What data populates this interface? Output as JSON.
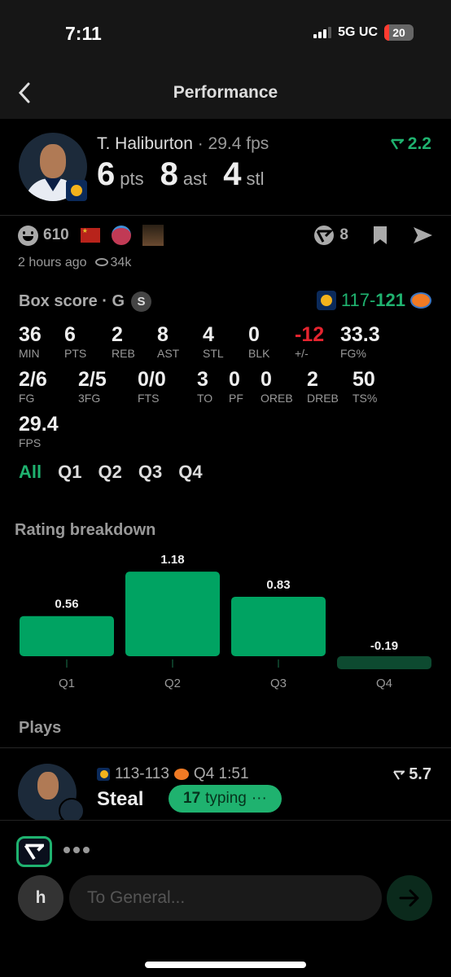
{
  "status_bar": {
    "time": "7:11",
    "network": "5G UC",
    "battery": "20"
  },
  "header": {
    "title": "Performance"
  },
  "player": {
    "name": "T. Haliburton",
    "fps": "· 29.4 fps",
    "rating": "2.2",
    "stats": [
      {
        "value": "6",
        "unit": "pts"
      },
      {
        "value": "8",
        "unit": "ast"
      },
      {
        "value": "4",
        "unit": "stl"
      }
    ]
  },
  "social": {
    "reaction_count": "610",
    "time_ago": "2 hours ago",
    "views": "34k",
    "vote_count": "8"
  },
  "box_score": {
    "title": "Box score · G",
    "badge": "S",
    "team_score": "117",
    "opp_score": "121",
    "score_sep": "-",
    "row1": [
      {
        "v": "36",
        "l": "MIN"
      },
      {
        "v": "6",
        "l": "PTS"
      },
      {
        "v": "2",
        "l": "REB"
      },
      {
        "v": "8",
        "l": "AST"
      },
      {
        "v": "4",
        "l": "STL"
      },
      {
        "v": "0",
        "l": "BLK"
      },
      {
        "v": "-12",
        "l": "+/-"
      },
      {
        "v": "33.3",
        "l": "FG%"
      }
    ],
    "row2": [
      {
        "v": "2/6",
        "l": "FG"
      },
      {
        "v": "2/5",
        "l": "3FG"
      },
      {
        "v": "0/0",
        "l": "FTS"
      },
      {
        "v": "3",
        "l": "TO"
      },
      {
        "v": "0",
        "l": "PF"
      },
      {
        "v": "0",
        "l": "OREB"
      },
      {
        "v": "2",
        "l": "DREB"
      },
      {
        "v": "50",
        "l": "TS%"
      }
    ],
    "row3": [
      {
        "v": "29.4",
        "l": "FPS"
      }
    ],
    "tabs": [
      "All",
      "Q1",
      "Q2",
      "Q3",
      "Q4"
    ],
    "active_tab": "All"
  },
  "rating_breakdown": {
    "title": "Rating breakdown"
  },
  "chart_data": {
    "type": "bar",
    "title": "Rating breakdown",
    "categories": [
      "Q1",
      "Q2",
      "Q3",
      "Q4"
    ],
    "values": [
      0.56,
      1.18,
      0.83,
      -0.19
    ],
    "labels": [
      "0.56",
      "1.18",
      "0.83",
      "-0.19"
    ],
    "positive_color": "#00a362",
    "negative_color": "#0d4a30",
    "xlabel": "",
    "ylabel": ""
  },
  "plays": {
    "title": "Plays",
    "items": [
      {
        "score": "113-113",
        "time": "Q4 1:51",
        "action": "Steal",
        "rating": "5.7",
        "typing_count": "17",
        "typing_label": "typing",
        "typing_dots": "···"
      }
    ]
  },
  "composer": {
    "user_initial": "h",
    "placeholder": "To General..."
  },
  "colors": {
    "accent": "#1fb26f",
    "negative": "#e5242f",
    "bg": "#000000"
  }
}
